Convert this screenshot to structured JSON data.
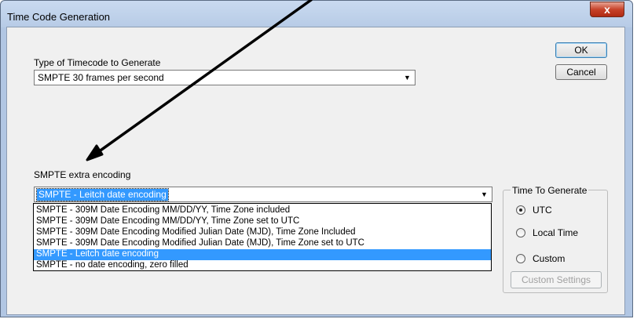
{
  "window": {
    "title": "Time Code Generation",
    "close_glyph": "x"
  },
  "timecode_type": {
    "label": "Type of Timecode to Generate",
    "selected": "SMPTE 30 frames per second",
    "arrow_glyph": "▼"
  },
  "buttons": {
    "ok": "OK",
    "cancel": "Cancel",
    "custom_settings": "Custom Settings"
  },
  "smpte_extra": {
    "label": "SMPTE extra encoding",
    "selected": "SMPTE - Leitch date encoding",
    "arrow_glyph": "▼",
    "options": [
      "SMPTE - 309M Date Encoding MM/DD/YY, Time Zone included",
      "SMPTE - 309M Date Encoding MM/DD/YY, Time Zone set to UTC",
      "SMPTE - 309M Date Encoding Modified Julian Date (MJD), Time Zone Included",
      "SMPTE - 309M Date Encoding Modified Julian Date (MJD), Time Zone set to UTC",
      "SMPTE - Leitch date encoding",
      "SMPTE - no date encoding, zero filled"
    ],
    "highlighted_option": 4
  },
  "time_to_generate": {
    "label": "Time To Generate",
    "options": [
      "UTC",
      "Local Time",
      "Custom"
    ],
    "selected": "UTC"
  },
  "colors": {
    "selection": "#3399ff",
    "close_button": "#c7432a",
    "annotation_arrow": "#000000"
  }
}
